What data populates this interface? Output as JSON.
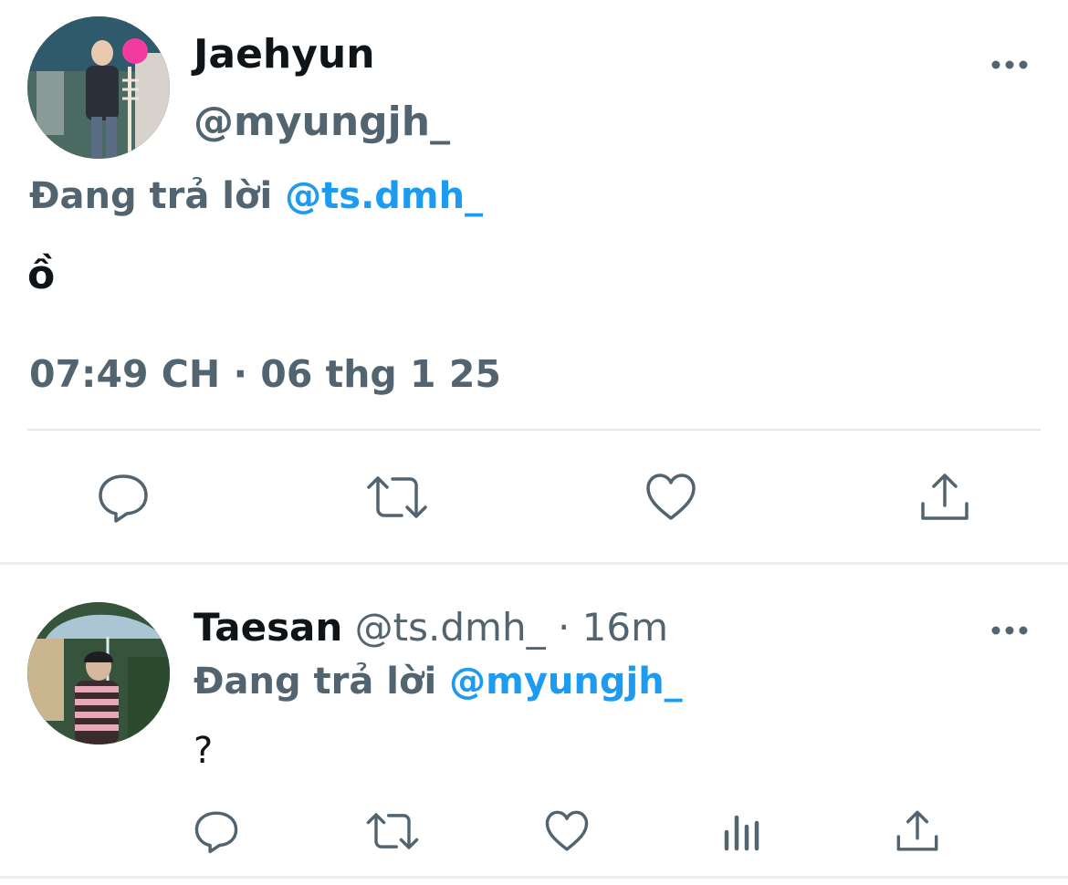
{
  "main_tweet": {
    "display_name": "Jaehyun",
    "handle": "@myungjh_",
    "replying_prefix": "Đang trả lời",
    "replying_to": "@ts.dmh_",
    "text": "ồ",
    "timestamp": "07:49 CH · 06 thg 1 25",
    "more_icon": "more-horizontal-icon",
    "actions": {
      "reply_icon": "reply-icon",
      "retweet_icon": "retweet-icon",
      "like_icon": "heart-icon",
      "share_icon": "share-icon"
    }
  },
  "reply_tweet": {
    "display_name": "Taesan",
    "handle": "@ts.dmh_",
    "separator": "·",
    "age": "16m",
    "replying_prefix": "Đang trả lời",
    "replying_to": "@myungjh_",
    "text": "?",
    "more_icon": "more-horizontal-icon",
    "actions": {
      "reply_icon": "reply-icon",
      "retweet_icon": "retweet-icon",
      "like_icon": "heart-icon",
      "views_icon": "views-icon",
      "share_icon": "share-icon"
    }
  },
  "colors": {
    "text_primary": "#0f1419",
    "text_secondary": "#536471",
    "mention": "#1d9bf0",
    "divider": "#e6e9ec",
    "background": "#ffffff"
  }
}
